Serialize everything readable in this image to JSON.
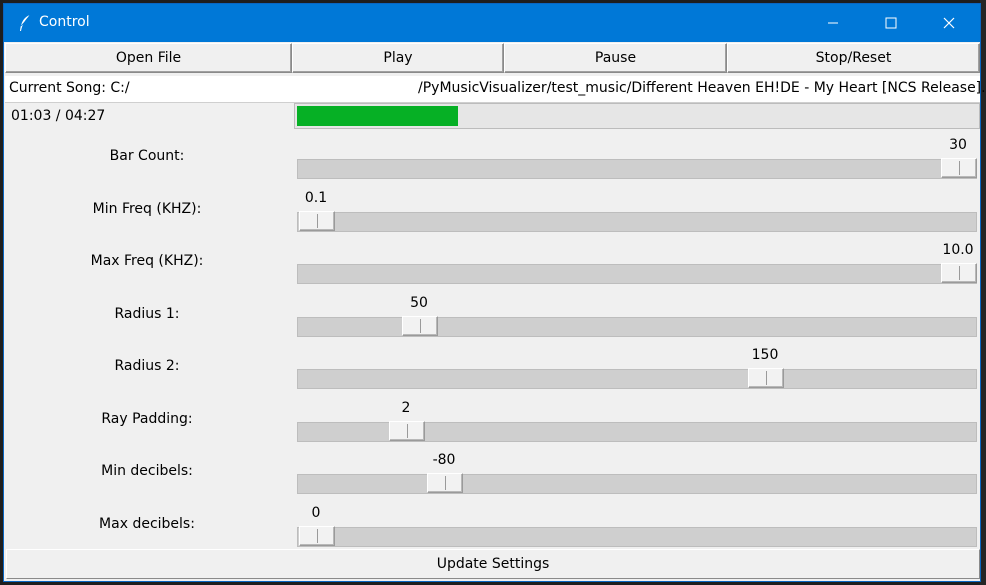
{
  "window": {
    "title": "Control"
  },
  "toolbar": {
    "open_file": "Open File",
    "play": "Play",
    "pause": "Pause",
    "stop_reset": "Stop/Reset"
  },
  "song": {
    "label": "Current Song: C:/",
    "path": "/PyMusicVisualizer/test_music/Different Heaven EH!DE - My Heart [NCS Release].wav"
  },
  "playback": {
    "time": "01:03 / 04:27",
    "progress_fraction": 0.236
  },
  "sliders": [
    {
      "label": "Bar Count:",
      "value": "30",
      "fraction": 1.0
    },
    {
      "label": "Min Freq (KHZ):",
      "value": "0.1",
      "fraction": 0.0
    },
    {
      "label": "Max Freq (KHZ):",
      "value": "10.0",
      "fraction": 1.0
    },
    {
      "label": "Radius 1:",
      "value": "50",
      "fraction": 0.16
    },
    {
      "label": "Radius 2:",
      "value": "150",
      "fraction": 0.7
    },
    {
      "label": "Ray Padding:",
      "value": "2",
      "fraction": 0.14
    },
    {
      "label": "Min decibels:",
      "value": "-80",
      "fraction": 0.2
    },
    {
      "label": "Max decibels:",
      "value": "0",
      "fraction": 0.0
    }
  ],
  "update_button": "Update Settings",
  "colors": {
    "titlebar": "#0078d7",
    "progress": "#06b025"
  }
}
